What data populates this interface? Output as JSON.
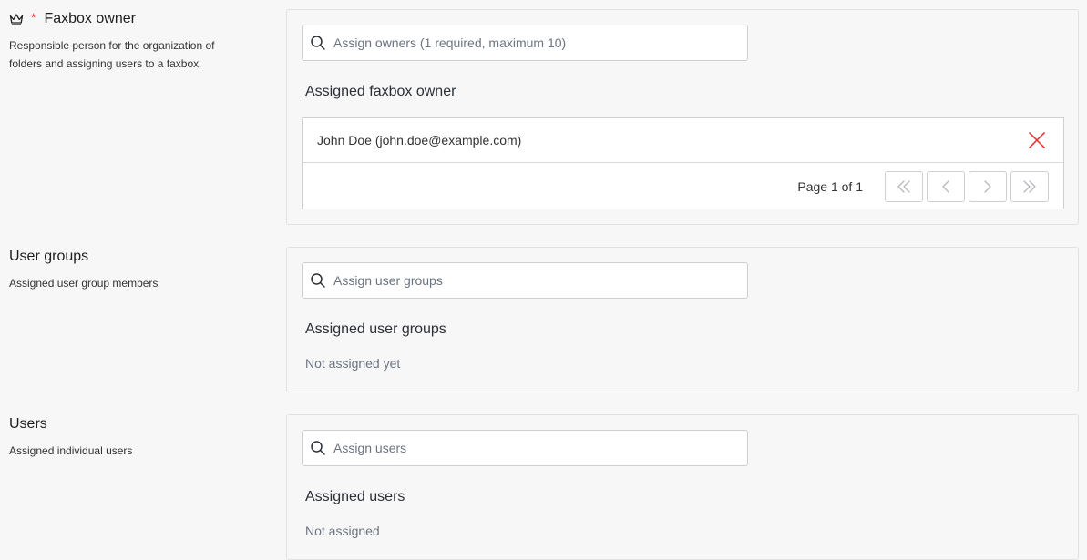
{
  "owner_section": {
    "title": "Faxbox owner",
    "required_mark": "*",
    "description": "Responsible person for the organization of folders and assigning users to a faxbox",
    "search_placeholder": "Assign owners (1 required, maximum 10)",
    "subheading": "Assigned faxbox owner",
    "owners": [
      {
        "display": "John Doe (john.doe@example.com)"
      }
    ],
    "pagination": {
      "text": "Page 1 of 1"
    }
  },
  "groups_section": {
    "title": "User groups",
    "description": "Assigned user group members",
    "search_placeholder": "Assign user groups",
    "subheading": "Assigned user groups",
    "empty_text": "Not assigned yet"
  },
  "users_section": {
    "title": "Users",
    "description": "Assigned individual users",
    "search_placeholder": "Assign users",
    "subheading": "Assigned users",
    "empty_text": "Not assigned"
  },
  "icons": {
    "owner": "crown-icon",
    "search": "search-icon",
    "remove": "close-icon",
    "first_page": "double-chevron-left-icon",
    "prev_page": "chevron-left-icon",
    "next_page": "chevron-right-icon",
    "last_page": "double-chevron-right-icon"
  },
  "colors": {
    "required": "#e03a3a",
    "remove": "#e03a3a",
    "placeholder": "#6b7480",
    "border": "#cfcfcf",
    "background": "#f7f7f7"
  }
}
